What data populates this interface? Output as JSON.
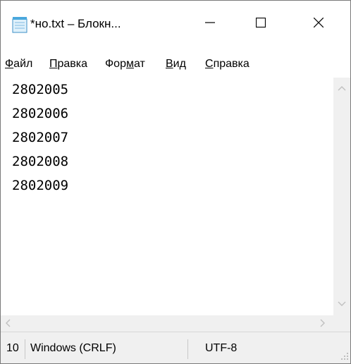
{
  "window": {
    "title": "*но.txt – Блокн...",
    "buttons": {
      "minimize": "—",
      "maximize": "☐",
      "close": "✕"
    }
  },
  "menu": {
    "items": [
      {
        "label": "Файл",
        "access_key": "Ф"
      },
      {
        "label": "Правка",
        "access_key": "П"
      },
      {
        "label": "Формат",
        "access_key": "м"
      },
      {
        "label": "Вид",
        "access_key": "В"
      },
      {
        "label": "Справка",
        "access_key": "С"
      }
    ]
  },
  "editor": {
    "lines": [
      "2802005",
      "2802006",
      "2802007",
      "2802008",
      "2802009"
    ]
  },
  "status": {
    "position": "10",
    "line_endings": "Windows (CRLF)",
    "encoding": "UTF-8"
  },
  "icons": {
    "app": "notepad-icon",
    "minimize": "minimize-icon",
    "maximize": "maximize-icon",
    "close": "close-icon",
    "scroll_up": "chevron-up-icon",
    "scroll_down": "chevron-down-icon",
    "scroll_left": "chevron-left-icon",
    "scroll_right": "chevron-right-icon",
    "grip": "resize-grip-icon"
  },
  "colors": {
    "window_bg": "#ffffff",
    "scrollbar_bg": "#f0f0f0",
    "statusbar_bg": "#f0f0f0",
    "icon_blue": "#4aa8dd"
  }
}
